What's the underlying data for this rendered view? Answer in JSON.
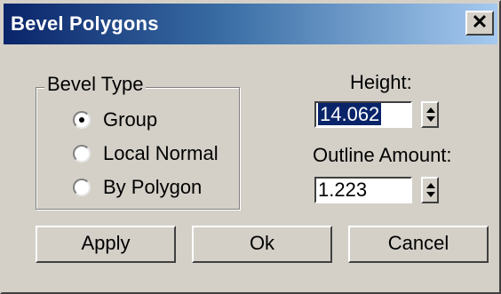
{
  "window": {
    "title": "Bevel Polygons",
    "close_label": "✕"
  },
  "bevel_type": {
    "legend": "Bevel Type",
    "options": [
      {
        "label": "Group",
        "selected": true
      },
      {
        "label": "Local Normal",
        "selected": false
      },
      {
        "label": "By Polygon",
        "selected": false
      }
    ]
  },
  "height": {
    "label": "Height:",
    "value": "14.062"
  },
  "outline": {
    "label": "Outline Amount:",
    "value": "1.223"
  },
  "buttons": {
    "apply": "Apply",
    "ok": "Ok",
    "cancel": "Cancel"
  },
  "colors": {
    "title_bar_start": "#0a246a",
    "title_bar_end": "#a6caf0",
    "dialog_bg": "#d4d0c8",
    "selection": "#0a246a"
  }
}
